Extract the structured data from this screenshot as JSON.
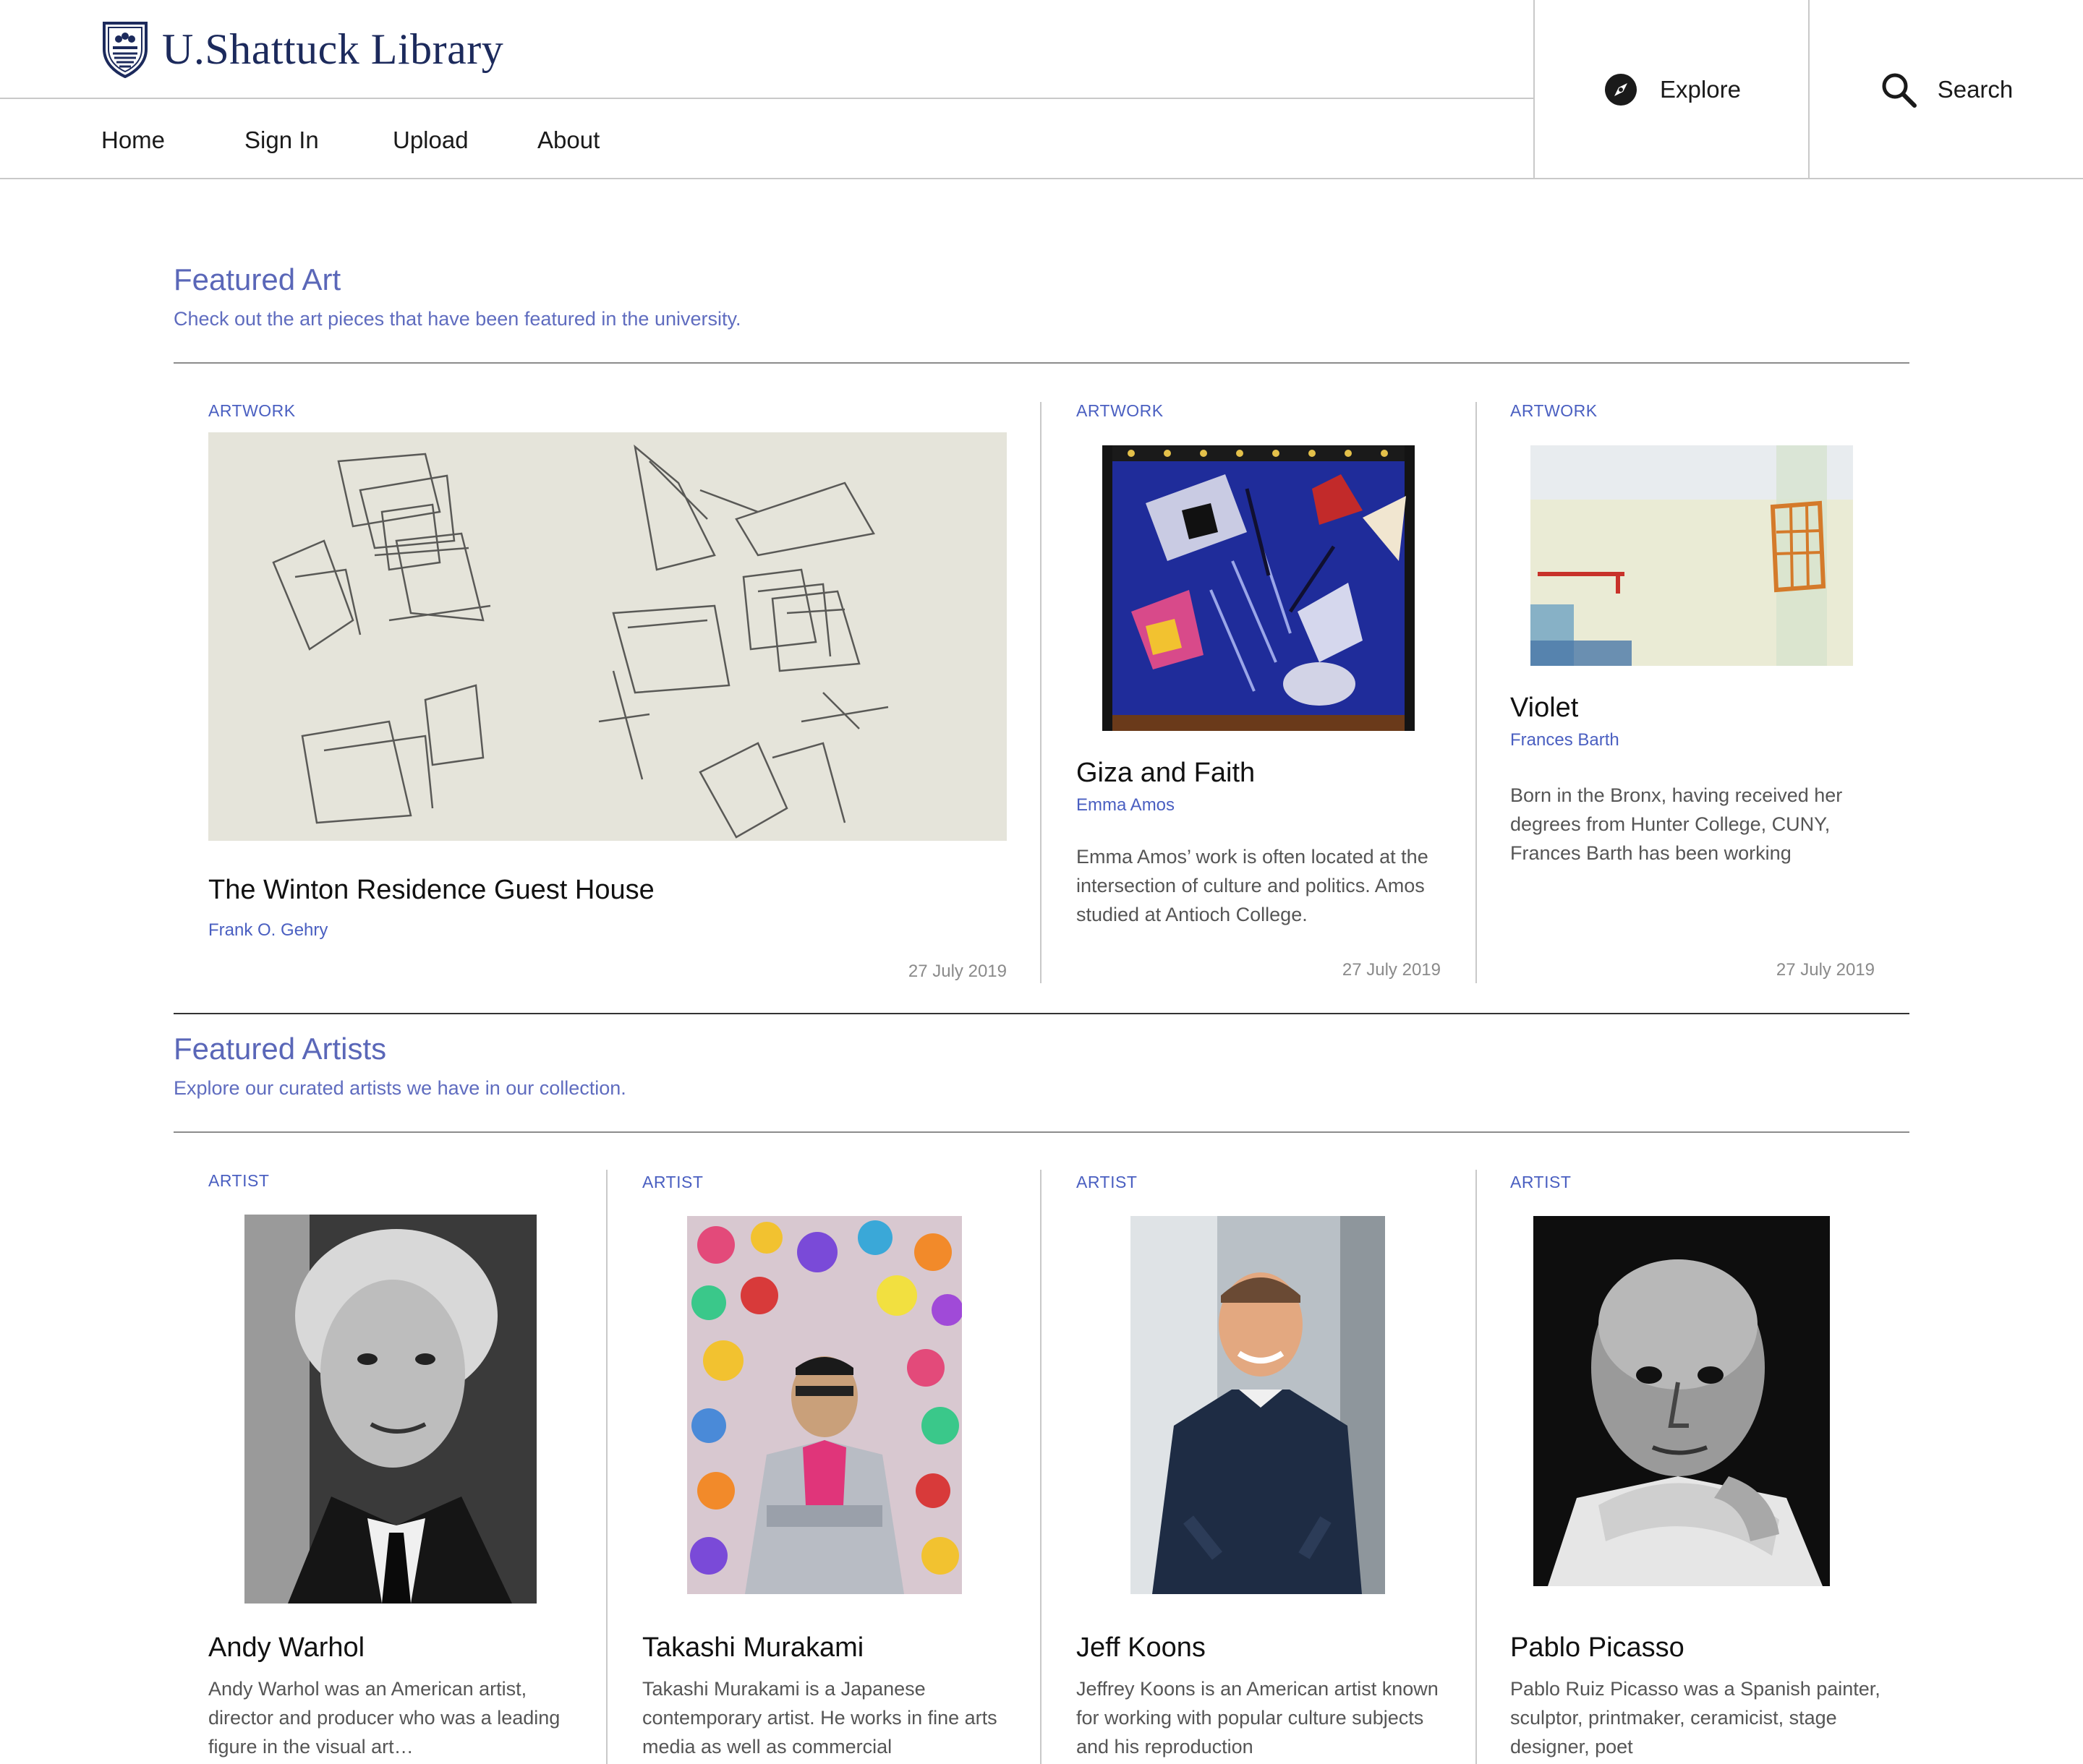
{
  "brand": {
    "name": "U.Shattuck Library",
    "crest": "shield-crest-icon",
    "color": "#1c2a5c"
  },
  "nav": {
    "items": [
      {
        "label": "Home"
      },
      {
        "label": "Sign In"
      },
      {
        "label": "Upload"
      },
      {
        "label": "About"
      }
    ],
    "explore": {
      "label": "Explore",
      "icon": "compass-icon"
    },
    "search": {
      "label": "Search",
      "icon": "magnifier-icon"
    }
  },
  "featured_art": {
    "title": "Featured Art",
    "subtitle": "Check out the art pieces that have been featured in the university.",
    "cards": [
      {
        "tag": "ARTWORK",
        "title": "The Winton Residence Guest House",
        "author": "Frank O. Gehry",
        "description": "",
        "date": "27 July 2019"
      },
      {
        "tag": "ARTWORK",
        "title": "Giza and Faith",
        "author": "Emma Amos",
        "description": "Emma Amos’ work is often located at the intersection of culture and politics. Amos studied at Antioch College.",
        "date": "27 July 2019"
      },
      {
        "tag": "ARTWORK",
        "title": "Violet",
        "author": "Frances Barth",
        "description": "Born in the Bronx, having received her degrees from Hunter College, CUNY, Frances Barth has been working",
        "date": "27 July 2019"
      }
    ]
  },
  "featured_artists": {
    "title": "Featured Artists",
    "subtitle": "Explore our curated artists we have in our collection.",
    "cards": [
      {
        "tag": "ARTIST",
        "name": "Andy Warhol",
        "description": "Andy Warhol was an American artist, director and producer who was a leading figure in the visual art…"
      },
      {
        "tag": "ARTIST",
        "name": "Takashi Murakami",
        "description": "Takashi Murakami is a Japanese contemporary artist. He works in fine arts media as well as commercial"
      },
      {
        "tag": "ARTIST",
        "name": "Jeff Koons",
        "description": "Jeffrey Koons is an American artist known for working with popular culture subjects and his reproduction"
      },
      {
        "tag": "ARTIST",
        "name": "Pablo Picasso",
        "description": "Pablo Ruiz Picasso was a Spanish painter, sculptor, printmaker, ceramicist, stage designer, poet"
      }
    ]
  },
  "colors": {
    "accent": "#5a67b8",
    "link": "#4a5fc1",
    "rule": "#c9c9c9"
  }
}
